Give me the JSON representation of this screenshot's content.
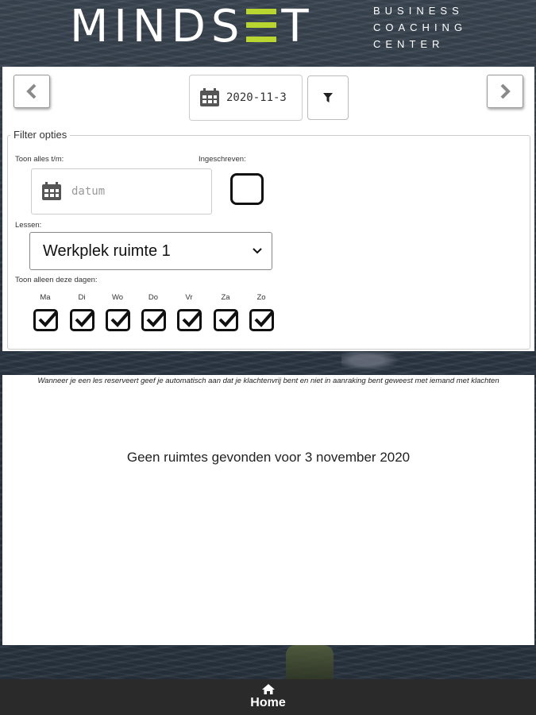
{
  "brand": {
    "name_left": "MINDS",
    "name_right": "T",
    "subtitle": [
      "BUSINESS",
      "COACHING",
      "CENTER"
    ],
    "accent_color": "#b9d530"
  },
  "toolbar": {
    "prev_icon": "chevron-left-icon",
    "next_icon": "chevron-right-icon",
    "date_value": "2020-11-3",
    "filter_icon": "filter-icon"
  },
  "filters": {
    "legend": "Filter opties",
    "show_until_label": "Toon alles t/m:",
    "date_placeholder": "datum",
    "registered_label": "Ingeschreven:",
    "registered_checked": false,
    "lessons_label": "Lessen:",
    "lessons_selected": "Werkplek ruimte 1",
    "days_label": "Toon alleen deze dagen:",
    "days": [
      {
        "label": "Ma",
        "checked": true
      },
      {
        "label": "Di",
        "checked": true
      },
      {
        "label": "Wo",
        "checked": true
      },
      {
        "label": "Do",
        "checked": true
      },
      {
        "label": "Vr",
        "checked": true
      },
      {
        "label": "Za",
        "checked": true
      },
      {
        "label": "Zo",
        "checked": true
      }
    ]
  },
  "results": {
    "notice": "Wanneer je een les reserveert geef je automatisch aan dat je klachtenvrij bent en niet in aanraking bent geweest met iemand met klachten",
    "empty_message": "Geen ruimtes gevonden voor 3 november 2020"
  },
  "footer": {
    "home_icon": "home-icon",
    "home_label": "Home"
  }
}
